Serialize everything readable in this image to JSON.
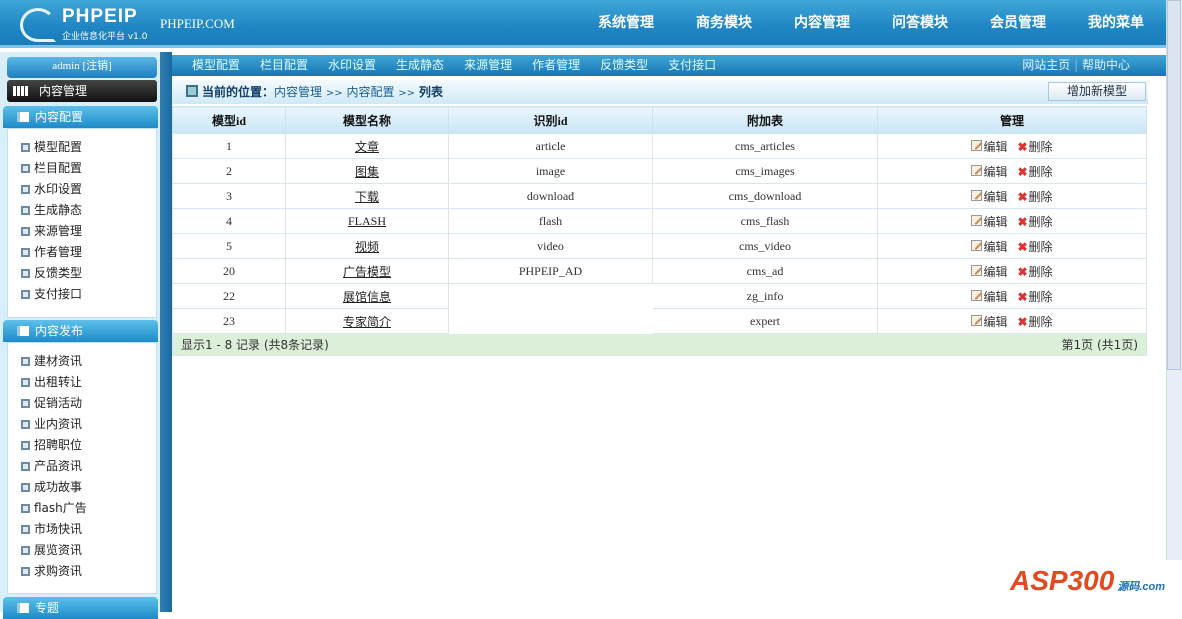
{
  "header": {
    "logo_title": "PHPEIP",
    "logo_sub": "企业信息化平台 v1.0",
    "site": "PHPEIP.COM",
    "nav": [
      "系统管理",
      "商务模块",
      "内容管理",
      "问答模块",
      "会员管理",
      "我的菜单"
    ]
  },
  "sidebar": {
    "user": "admin [注销]",
    "current": "内容管理",
    "sections": [
      {
        "title": "内容配置",
        "items": [
          "模型配置",
          "栏目配置",
          "水印设置",
          "生成静态",
          "来源管理",
          "作者管理",
          "反馈类型",
          "支付接口"
        ]
      },
      {
        "title": "内容发布",
        "items": [
          "建材资讯",
          "出租转让",
          "促销活动",
          "业内资讯",
          "招聘职位",
          "产品资讯",
          "成功故事",
          "flash广告",
          "市场快讯",
          "展览资讯",
          "求购资讯"
        ]
      },
      {
        "title": "专题",
        "items": []
      }
    ]
  },
  "subnav": {
    "items": [
      "模型配置",
      "栏目配置",
      "水印设置",
      "生成静态",
      "来源管理",
      "作者管理",
      "反馈类型",
      "支付接口"
    ],
    "home": "网站主页",
    "sep": "|",
    "help": "帮助中心"
  },
  "breadcrumb": {
    "label": "当前的位置：",
    "path1": "内容管理",
    "arrow": ">>",
    "path2": "内容配置",
    "current": "列表"
  },
  "add_button": "增加新模型",
  "table": {
    "headers": [
      "模型id",
      "模型名称",
      "识别id",
      "附加表",
      "管理"
    ],
    "rows": [
      [
        "1",
        "文章",
        "article",
        "cms_articles"
      ],
      [
        "2",
        "图集",
        "image",
        "cms_images"
      ],
      [
        "3",
        "下载",
        "download",
        "cms_download"
      ],
      [
        "4",
        "FLASH",
        "flash",
        "cms_flash"
      ],
      [
        "5",
        "视频",
        "video",
        "cms_video"
      ],
      [
        "20",
        "广告模型",
        "PHPEIP_AD",
        "cms_ad"
      ],
      [
        "22",
        "展馆信息",
        "",
        "zg_info"
      ],
      [
        "23",
        "专家简介",
        "",
        "expert"
      ]
    ],
    "edit": "编辑",
    "delete": "删除",
    "footer_left": "显示1 - 8 记录 (共8条记录)",
    "footer_right": "第1页 (共1页)"
  },
  "watermark": {
    "text": "ASP300",
    "sub": "源码 .com"
  }
}
